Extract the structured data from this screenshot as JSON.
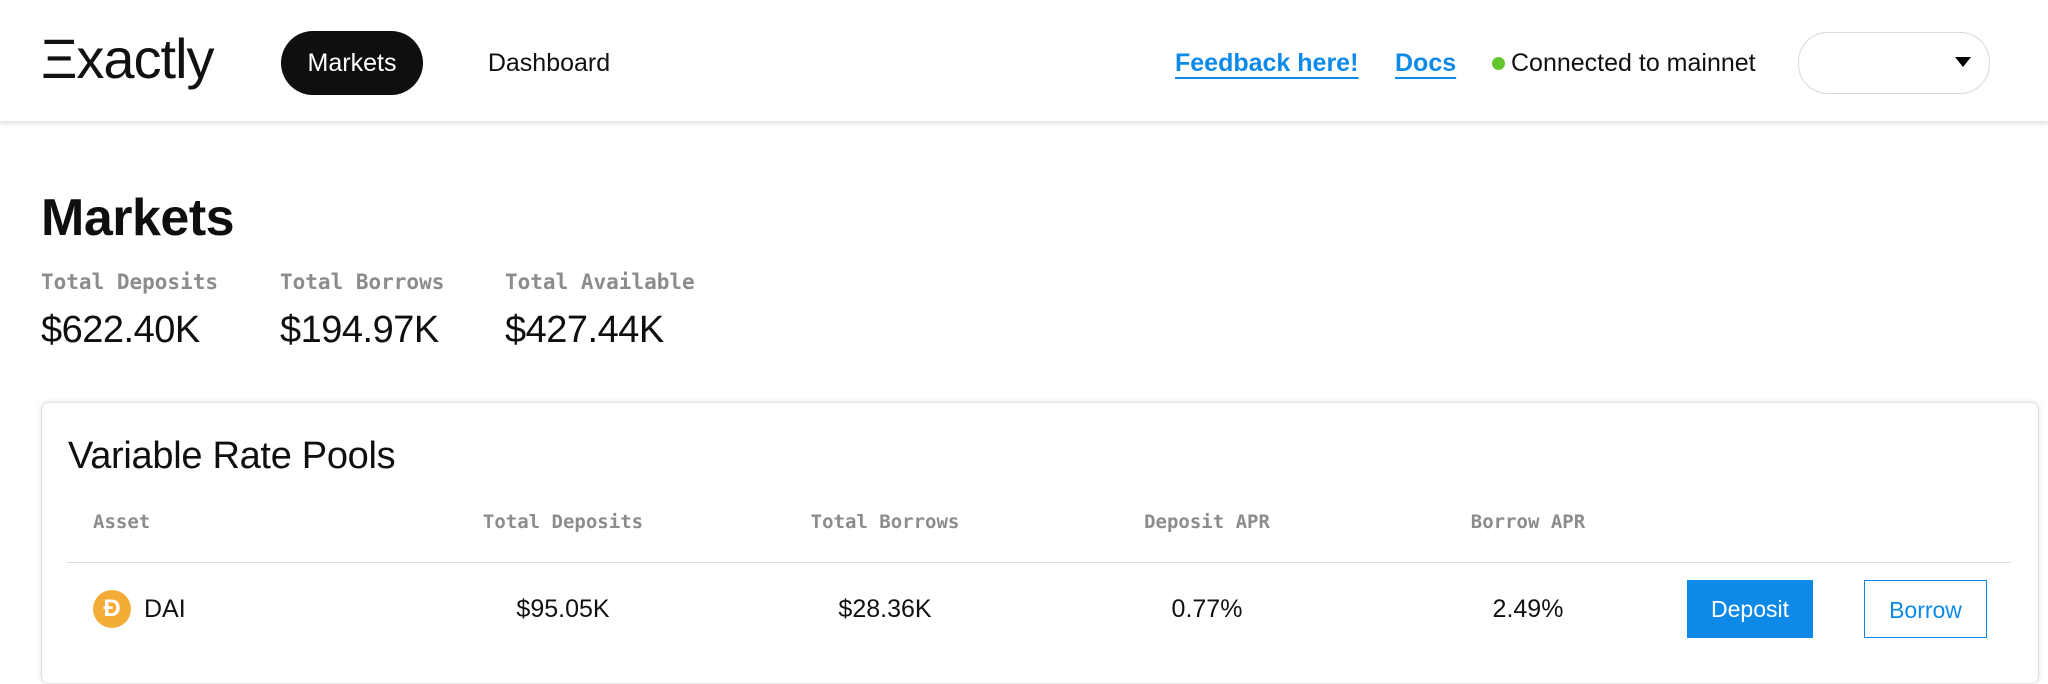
{
  "header": {
    "logo_text": "Ξxactly",
    "nav": [
      {
        "label": "Markets",
        "active": true
      },
      {
        "label": "Dashboard",
        "active": false
      }
    ],
    "feedback_link": "Feedback here!",
    "docs_link": "Docs",
    "status_text": "Connected to mainnet",
    "wallet_select_value": ""
  },
  "page": {
    "title": "Markets",
    "stats": [
      {
        "label": "Total Deposits",
        "value": "$622.40K"
      },
      {
        "label": "Total Borrows",
        "value": "$194.97K"
      },
      {
        "label": "Total Available",
        "value": "$427.44K"
      }
    ]
  },
  "pools": {
    "title": "Variable Rate Pools",
    "columns": [
      "Asset",
      "Total Deposits",
      "Total Borrows",
      "Deposit APR",
      "Borrow APR"
    ],
    "rows": [
      {
        "asset": "DAI",
        "asset_icon": "dai-icon",
        "total_deposits": "$95.05K",
        "total_borrows": "$28.36K",
        "deposit_apr": "0.77%",
        "borrow_apr": "2.49%",
        "deposit_label": "Deposit",
        "borrow_label": "Borrow"
      }
    ]
  },
  "colors": {
    "accent": "#0d8ae8",
    "nav_active_bg": "#0f0f0f",
    "status_green": "#63c42c",
    "dai_icon": "#f5ac37"
  }
}
